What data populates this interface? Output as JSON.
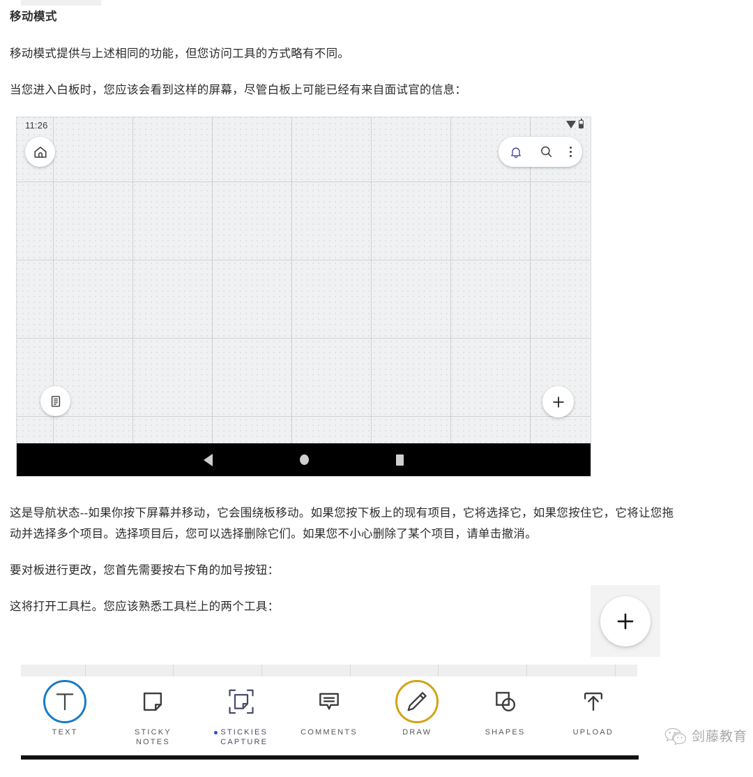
{
  "article": {
    "heading": "移动模式",
    "paragraphs": [
      "移动模式提供与上述相同的功能，但您访问工具的方式略有不同。",
      "当您进入白板时，您应该会看到这样的屏幕，尽管白板上可能已经有来自面试官的信息："
    ],
    "paragraphs_after": [
      "这是导航状态--如果你按下屏幕并移动，它会围绕板移动。如果您按下板上的现有项目，它将选择它，如果您按住它，它将让您拖动并选择多个项目。选择项目后，您可以选择删除它们。如果您不小心删除了某个项目，请单击撤消。",
      "要对板进行更改，您首先需要按右下角的加号按钮：",
      "这将打开工具栏。您应该熟悉工具栏上的两个工具："
    ]
  },
  "phone": {
    "status_bar": {
      "time": "11:26",
      "wifi_icon": "wifi-icon",
      "battery_icon": "battery-icon"
    },
    "top_left_button": {
      "icon": "home-icon"
    },
    "top_right_pill": [
      {
        "icon": "bell-icon",
        "color": "#3f3d9e"
      },
      {
        "icon": "search-icon",
        "color": "#3c3c3c"
      },
      {
        "icon": "overflow-menu-icon",
        "color": "#3c3c3c"
      }
    ],
    "bottom_left_button": {
      "icon": "document-list-icon"
    },
    "bottom_right_button": {
      "icon": "plus-icon"
    },
    "nav_bar": [
      {
        "icon": "android-back-icon"
      },
      {
        "icon": "android-home-icon"
      },
      {
        "icon": "android-recents-icon"
      }
    ],
    "board_background": "#eff1f2"
  },
  "plus_figure": {
    "icon": "plus-icon",
    "background": "#f3f3f3"
  },
  "toolbar": {
    "tools": [
      {
        "label": "TEXT",
        "icon": "text-tool-icon",
        "ring": "#1a7bc4",
        "dot": false
      },
      {
        "label": "STICKY\nNOTES",
        "icon": "sticky-note-icon",
        "ring": null,
        "dot": false
      },
      {
        "label": "STICKIES\nCAPTURE",
        "icon": "stickies-capture-icon",
        "ring": null,
        "dot": true
      },
      {
        "label": "COMMENTS",
        "icon": "comment-bubble-icon",
        "ring": null,
        "dot": false
      },
      {
        "label": "DRAW",
        "icon": "pencil-draw-icon",
        "ring": "#d3a216",
        "dot": false
      },
      {
        "label": "SHAPES",
        "icon": "shapes-icon",
        "ring": null,
        "dot": false
      },
      {
        "label": "UPLOAD",
        "icon": "upload-arrow-icon",
        "ring": null,
        "dot": false
      }
    ],
    "accent_blue": "#1a7bc4",
    "accent_gold": "#d3a216",
    "accent_indigo": "#4a4a66"
  },
  "watermark": {
    "text": "剑藤教育",
    "icon": "wechat-icon"
  }
}
